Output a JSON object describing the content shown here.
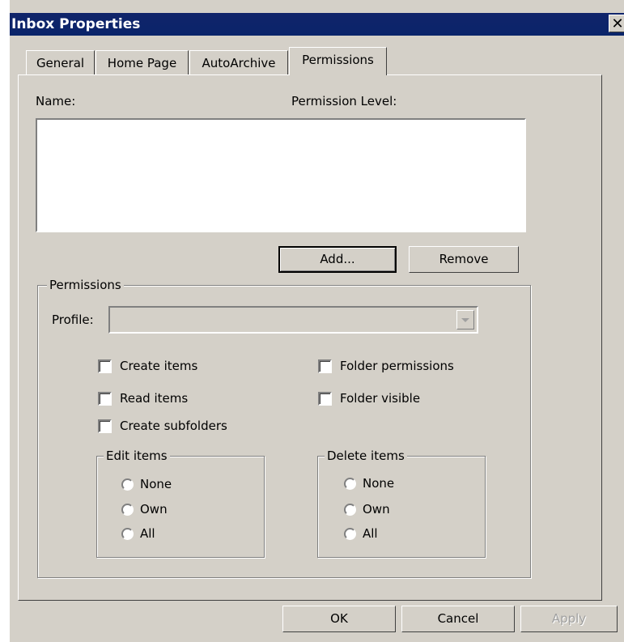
{
  "window": {
    "title": "Inbox Properties",
    "close_glyph": "✕"
  },
  "tabs": [
    {
      "label": "General",
      "active": false
    },
    {
      "label": "Home Page",
      "active": false
    },
    {
      "label": "AutoArchive",
      "active": false
    },
    {
      "label": "Permissions",
      "active": true
    }
  ],
  "permissions_tab": {
    "name_header": "Name:",
    "level_header": "Permission Level:",
    "list_items": [],
    "add_label": "Add...",
    "remove_label": "Remove",
    "group_title": "Permissions",
    "profile_label": "Profile:",
    "profile_value": "",
    "checkboxes_left": [
      {
        "label": "Create items",
        "checked": false
      },
      {
        "label": "Read items",
        "checked": false
      },
      {
        "label": "Create subfolders",
        "checked": false
      }
    ],
    "checkboxes_right": [
      {
        "label": "Folder permissions",
        "checked": false
      },
      {
        "label": "Folder visible",
        "checked": false
      }
    ],
    "edit_items": {
      "title": "Edit items",
      "options": [
        "None",
        "Own",
        "All"
      ],
      "selected": null
    },
    "delete_items": {
      "title": "Delete items",
      "options": [
        "None",
        "Own",
        "All"
      ],
      "selected": null
    }
  },
  "footer": {
    "ok_label": "OK",
    "cancel_label": "Cancel",
    "apply_label": "Apply",
    "apply_enabled": false
  },
  "colors": {
    "title_bar": "#0a246a",
    "dialog_face": "#d4d0c8"
  }
}
